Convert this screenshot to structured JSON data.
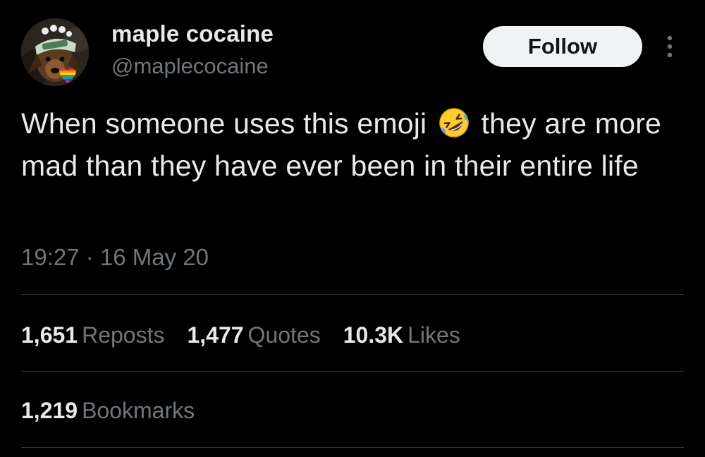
{
  "colors": {
    "background": "#000000",
    "primary_text": "#e7e9ea",
    "secondary_text": "#71767b",
    "divider": "#2f3336",
    "follow_button_bg": "#eff3f4",
    "follow_button_text": "#0f1419"
  },
  "author": {
    "display_name": "maple cocaine",
    "handle": "@maplecocaine",
    "avatar_icon": "dog-avatar-icon",
    "badge_icon": "rainbow-heart-icon"
  },
  "header": {
    "follow_label": "Follow",
    "more_icon": "more-options-icon"
  },
  "tweet": {
    "text_before_emoji": "When someone uses this emoji",
    "emoji_icon": "rolling-on-floor-laughing-emoji-icon",
    "text_after_emoji": "they are more mad than they have ever been in their entire life",
    "timestamp": "19:27 · 16 May 20"
  },
  "stats": {
    "reposts_count": "1,651",
    "reposts_label": "Reposts",
    "quotes_count": "1,477",
    "quotes_label": "Quotes",
    "likes_count": "10.3K",
    "likes_label": "Likes",
    "bookmarks_count": "1,219",
    "bookmarks_label": "Bookmarks"
  }
}
